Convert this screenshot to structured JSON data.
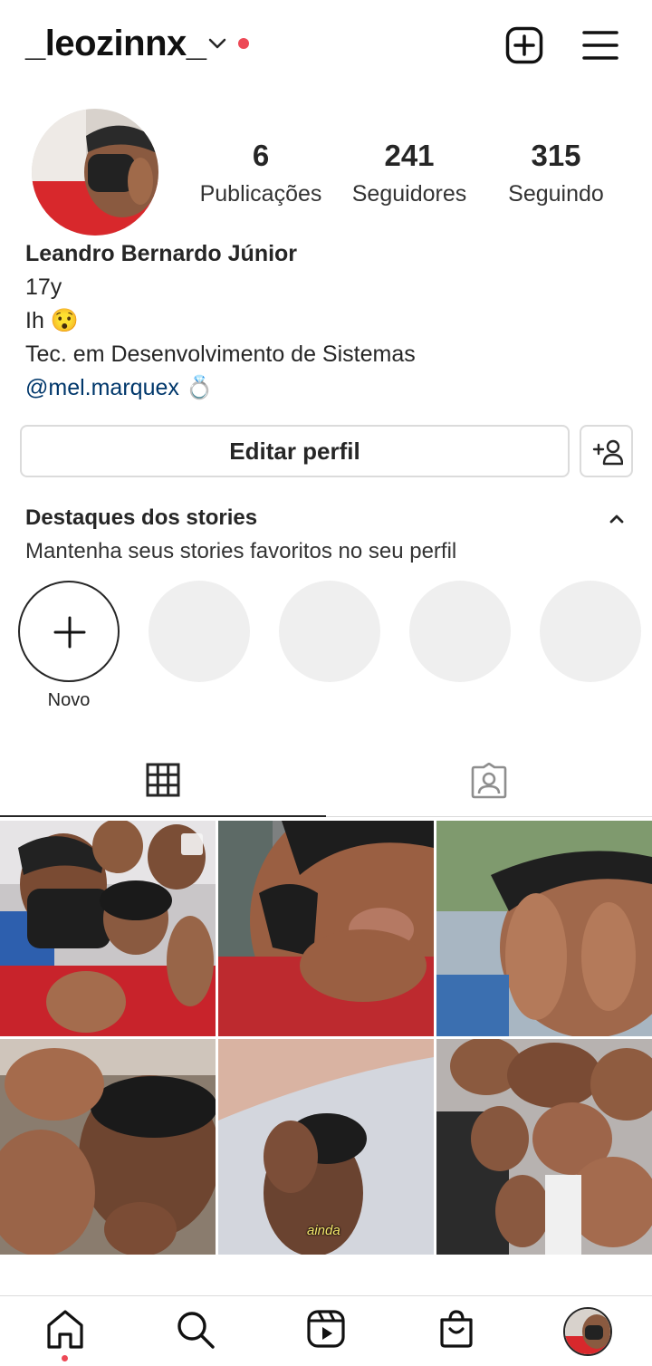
{
  "header": {
    "username": "_leozinnx_",
    "icons": [
      "chevron-down-icon",
      "notification-dot",
      "new-post-icon",
      "menu-icon"
    ]
  },
  "profile": {
    "stats": [
      {
        "value": "6",
        "label": "Publicações"
      },
      {
        "value": "241",
        "label": "Seguidores"
      },
      {
        "value": "315",
        "label": "Seguindo"
      }
    ],
    "bio": {
      "name": "Leandro Bernardo Júnior",
      "line1": "17y",
      "line2": "Ih 😯",
      "line3": "Tec. em Desenvolvimento de Sistemas",
      "mention": "@mel.marquex",
      "mention_emoji": "💍"
    }
  },
  "actions": {
    "edit_label": "Editar perfil",
    "discover_icon": "add-person-icon"
  },
  "highlights": {
    "title": "Destaques dos stories",
    "subtitle": "Mantenha seus stories favoritos no seu perfil",
    "new_label": "Novo",
    "placeholders": 4
  },
  "tabs": [
    "grid-icon",
    "tagged-icon"
  ],
  "posts": {
    "overlay_text": "ainda",
    "count": 6
  },
  "bottom_nav": [
    "home-icon",
    "search-icon",
    "reels-icon",
    "shop-icon",
    "profile-avatar"
  ],
  "colors": {
    "accent_red": "#ed4956",
    "link_blue": "#00376b",
    "border": "#dbdbdb",
    "placeholder_gray": "#efefef"
  }
}
